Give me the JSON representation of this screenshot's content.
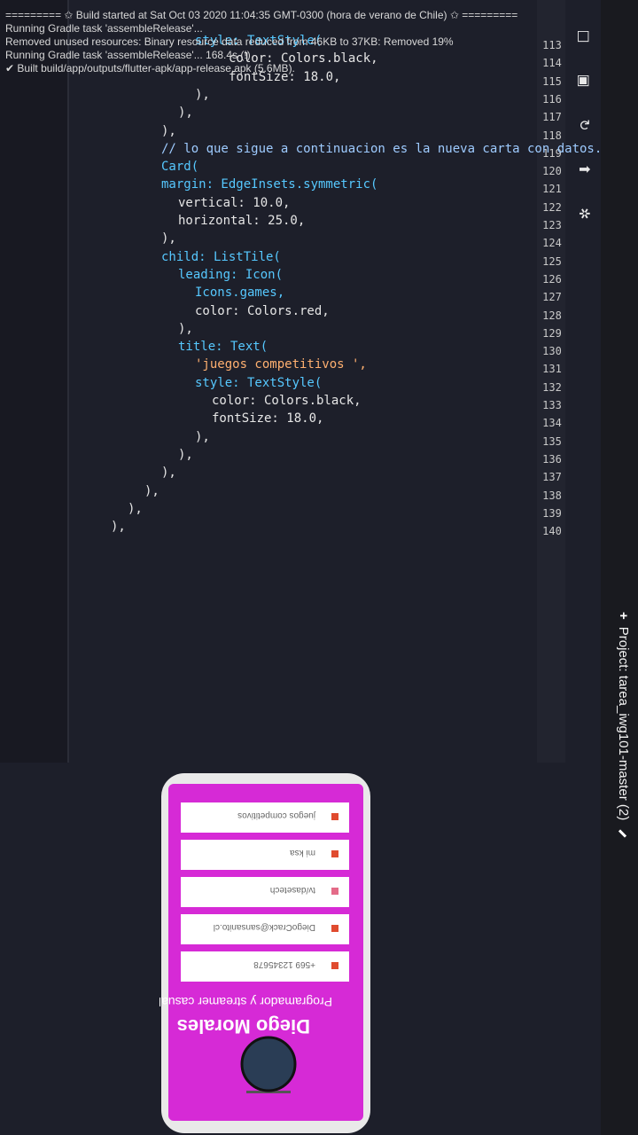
{
  "window": {
    "title": "Project: tarea_iwg101-master (2)"
  },
  "gutter": {
    "line_numbers": [
      "113",
      "114",
      "115",
      "116",
      "117",
      "118",
      "119",
      "120",
      "121",
      "122",
      "123",
      "124",
      "125",
      "126",
      "127",
      "128",
      "129",
      "130",
      "131",
      "132",
      "133",
      "134",
      "135",
      "136",
      "137",
      "138",
      "139",
      "140"
    ]
  },
  "code": {
    "lines": [
      "style: TextStyle(",
      "color: Colors.black,",
      "fontSize: 18.0,",
      "),",
      "),",
      "),",
      "// lo que sigue a continuacion es la nueva carta con datos.",
      "Card(",
      "margin: EdgeInsets.symmetric(",
      "vertical: 10.0,",
      "horizontal: 25.0,",
      "),",
      "child: ListTile(",
      "leading: Icon(",
      "Icons.games,",
      "color: Colors.red,",
      "),",
      "title: Text(",
      "'juegos competitivos ',",
      "style: TextStyle(",
      "color: Colors.black,",
      "fontSize: 18.0,",
      "),",
      "),",
      "),",
      "),",
      "),",
      "),"
    ]
  },
  "console": {
    "lines": [
      "========= ✩ Build started at Sat Oct 03 2020 11:04:35 GMT-0300 (hora de verano de Chile) ✩ =========",
      "Running Gradle task 'assembleRelease'...",
      "Removed unused resources: Binary resource data reduced from 46KB to 37KB: Removed 19%",
      "Running Gradle task 'assembleRelease'... 168.4s (!)",
      "✔ Built build/app/outputs/flutter-apk/app-release.apk (5.6MB)."
    ]
  },
  "phone": {
    "name": "Diego Morales",
    "subtitle": "Programador y streamer casual",
    "cards": [
      {
        "icon": "phone-icon",
        "text": "+569 12345678",
        "color": "#e04b2f"
      },
      {
        "icon": "mail-icon",
        "text": "DiegoCrack@sansanito.cl",
        "color": "#e04b2f"
      },
      {
        "icon": "twitch-icon",
        "text": "tv/dasetech",
        "color": "#e46b88"
      },
      {
        "icon": "home-icon",
        "text": "mi ksa",
        "color": "#e04b2f"
      },
      {
        "icon": "games-icon",
        "text": "juegos competitivos",
        "color": "#e04b2f"
      }
    ],
    "bg": "#d62ad6"
  },
  "colors": {
    "tab_green": "#5cd65c",
    "tab_red": "#ff3a1a",
    "tab_yellow": "#f0c020"
  }
}
